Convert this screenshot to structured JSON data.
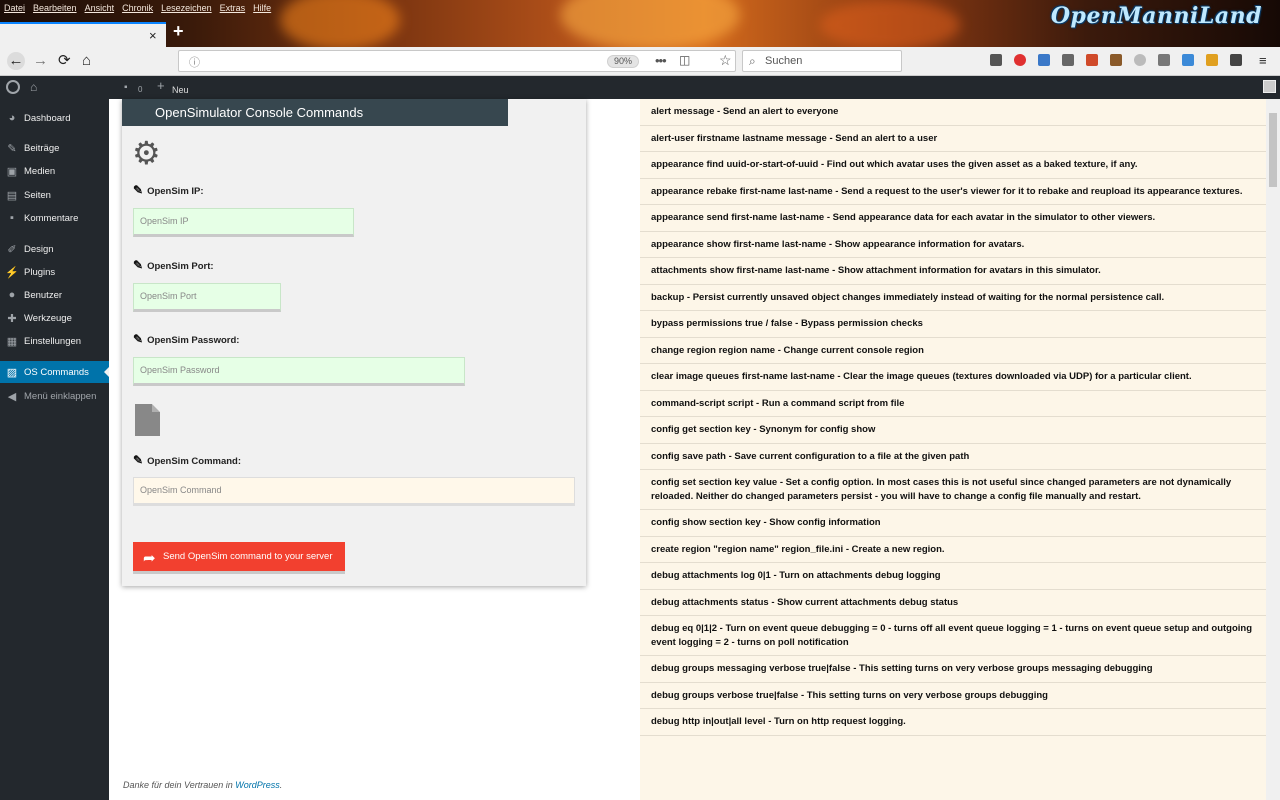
{
  "browser": {
    "menu": [
      "Datei",
      "Bearbeiten",
      "Ansicht",
      "Chronik",
      "Lesezeichen",
      "Extras",
      "Hilfe"
    ],
    "brand": "OpenManniLand",
    "tab_close": "×",
    "new_tab": "+",
    "zoom": "90%",
    "search_placeholder": "Suchen"
  },
  "adminbar": {
    "comments_count": "0",
    "new_label": "Neu"
  },
  "sidebar": {
    "items": [
      {
        "label": "Dashboard"
      },
      {
        "label": "Beiträge"
      },
      {
        "label": "Medien"
      },
      {
        "label": "Seiten"
      },
      {
        "label": "Kommentare"
      },
      {
        "label": "Design"
      },
      {
        "label": "Plugins"
      },
      {
        "label": "Benutzer"
      },
      {
        "label": "Werkzeuge"
      },
      {
        "label": "Einstellungen"
      },
      {
        "label": "OS Commands"
      },
      {
        "label": "Menü einklappen"
      }
    ]
  },
  "form": {
    "title": "OpenSimulator Console Commands",
    "ip_label": "OpenSim IP:",
    "ip_placeholder": "OpenSim IP",
    "port_label": "OpenSim Port:",
    "port_placeholder": "OpenSim Port",
    "password_label": "OpenSim Password:",
    "password_placeholder": "OpenSim Password",
    "command_label": "OpenSim Command:",
    "command_placeholder": "OpenSim Command",
    "send_label": "Send OpenSim command to your server"
  },
  "footer": {
    "text": "Danke für dein Vertrauen in ",
    "link": "WordPress",
    "end": "."
  },
  "commands": [
    "alert message - Send an alert to everyone",
    "alert-user firstname lastname message - Send an alert to a user",
    "appearance find uuid-or-start-of-uuid - Find out which avatar uses the given asset as a baked texture, if any.",
    "appearance rebake first-name last-name - Send a request to the user's viewer for it to rebake and reupload its appearance textures.",
    "appearance send first-name last-name - Send appearance data for each avatar in the simulator to other viewers.",
    "appearance show first-name last-name - Show appearance information for avatars.",
    "attachments show first-name last-name - Show attachment information for avatars in this simulator.",
    "backup - Persist currently unsaved object changes immediately instead of waiting for the normal persistence call.",
    "bypass permissions true / false - Bypass permission checks",
    "change region region name - Change current console region",
    "clear image queues first-name last-name - Clear the image queues (textures downloaded via UDP) for a particular client.",
    "command-script script - Run a command script from file",
    "config get section key - Synonym for config show",
    "config save path - Save current configuration to a file at the given path",
    "config set section key value - Set a config option. In most cases this is not useful since changed parameters are not dynamically reloaded. Neither do changed parameters persist - you will have to change a config file manually and restart.",
    "config show section key - Show config information",
    "create region \"region name\" region_file.ini - Create a new region.",
    "debug attachments log 0|1 - Turn on attachments debug logging",
    "debug attachments status - Show current attachments debug status",
    "debug eq 0|1|2 - Turn on event queue debugging = 0 - turns off all event queue logging = 1 - turns on event queue setup and outgoing event logging = 2 - turns on poll notification",
    "debug groups messaging verbose true|false - This setting turns on very verbose groups messaging debugging",
    "debug groups verbose true|false - This setting turns on very verbose groups debugging",
    "debug http in|out|all level - Turn on http request logging."
  ]
}
